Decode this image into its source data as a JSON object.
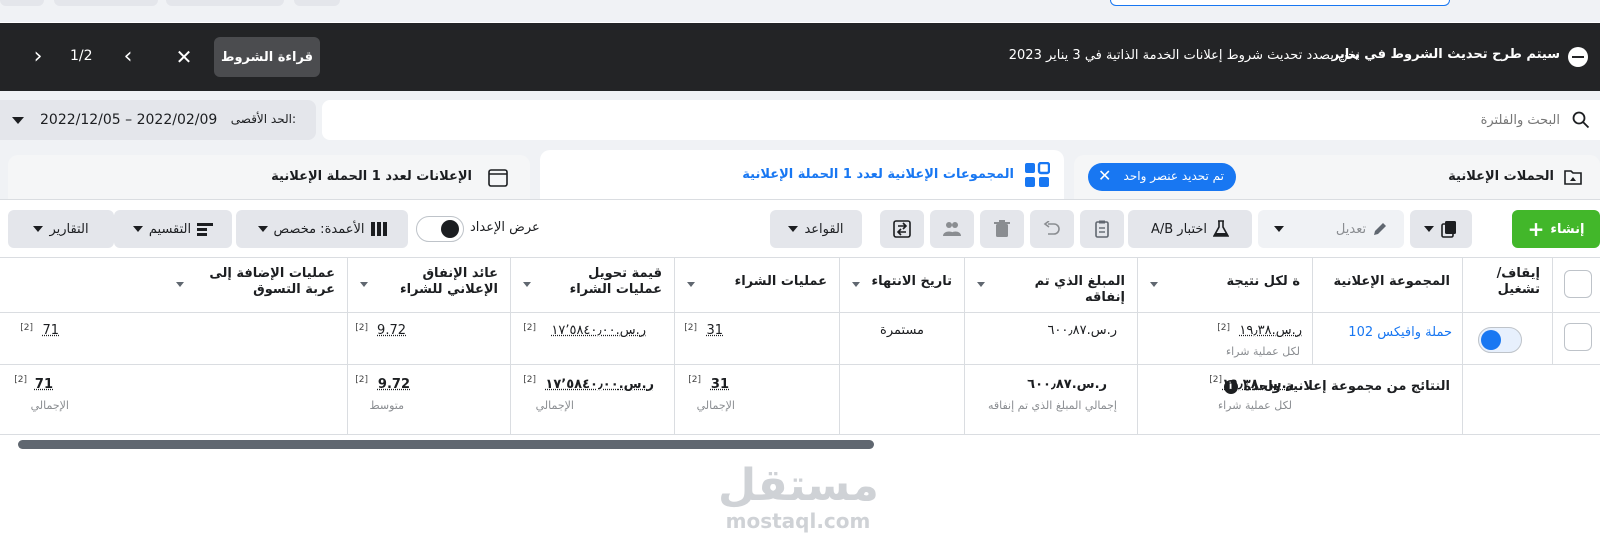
{
  "banner": {
    "title": "سيتم طرح تحديث الشروط في يناير",
    "text": "نحن بصدد تحديث شروط إعلانات الخدمة الذاتية في 3 يناير 2023",
    "terms_button": "قراءة الشروط",
    "pager": "1/2"
  },
  "search": {
    "placeholder": "البحث والفلترة",
    "date_label": "الحد الأقصى:",
    "date_range": "2022/12/05 – 2022/02/09"
  },
  "tabs": {
    "campaigns": "الحملات الإعلانية",
    "selected_chip": "تم تحديد عنصر واحد",
    "adsets": "المجموعات الإعلانية لعدد 1 الحملة الإعلانية",
    "ads": "الإعلانات لعدد 1 الحملة الإعلانية"
  },
  "toolbar": {
    "create": "إنشاء",
    "edit": "تعديل",
    "ab_test": "اختبار A/B",
    "rules": "القواعد",
    "setup_view": "عرض الإعداد",
    "columns": "الأعمدة: مخصص",
    "breakdown": "التقسيم",
    "reports": "التقارير"
  },
  "table": {
    "headers": {
      "toggle": "إيقاف/ تشغيل",
      "name": "المجموعة الإعلانية",
      "cpr": "ة لكل نتيجة",
      "spent": "المبلغ الذي تم إنفاقه",
      "end": "تاريخ الانتهاء",
      "purchases": "عمليات الشراء",
      "purchase_value": "قيمة تحويل عمليات الشراء",
      "roas": "عائد الإنفاق الإعلاني للشراء",
      "add_to_cart": "عمليات الإضافة إلى عربة التسوق"
    },
    "row1": {
      "name": "حملة وافيكس 102",
      "cpr": "ر.س.١٩٫٣٨",
      "cpr_note": "[2]",
      "cpr_sub": "لكل عملية شراء",
      "spent": "ر.س.٦٠٠٫٨٧",
      "end": "مستمرة",
      "purchases": "31",
      "purchases_note": "[2]",
      "purchase_value": "ر.س.١٧٬٥٨٤٠٫٠٠",
      "purchase_value_note": "[2]",
      "roas": "9.72",
      "roas_note": "[2]",
      "add_to_cart": "71",
      "add_to_cart_note": "[2]"
    },
    "summary": {
      "title": "النتائج من مجموعة إعلانية واحدة",
      "info": "i",
      "cpr": "ر.س.١٩٫٣٨",
      "cpr_note": "[2]",
      "cpr_sub": "لكل عملية شراء",
      "spent": "ر.س.٦٠٠٫٨٧",
      "spent_sub": "إجمالي المبلغ الذي تم إنفاقه",
      "purchases": "31",
      "purchases_note": "[2]",
      "purchases_sub": "الإجمالي",
      "purchase_value": "ر.س.١٧٬٥٨٤٠٫٠٠",
      "purchase_value_note": "[2]",
      "purchase_value_sub": "الإجمالي",
      "roas": "9.72",
      "roas_note": "[2]",
      "roas_sub": "متوسط",
      "add_to_cart": "71",
      "add_to_cart_note": "[2]",
      "add_to_cart_sub": "الإجمالي"
    }
  },
  "watermark": {
    "arabic": "مستقل",
    "latin": "mostaql.com"
  },
  "colors": {
    "accent": "#1877f2",
    "create_green": "#42b72a",
    "banner_bg": "#232426"
  }
}
